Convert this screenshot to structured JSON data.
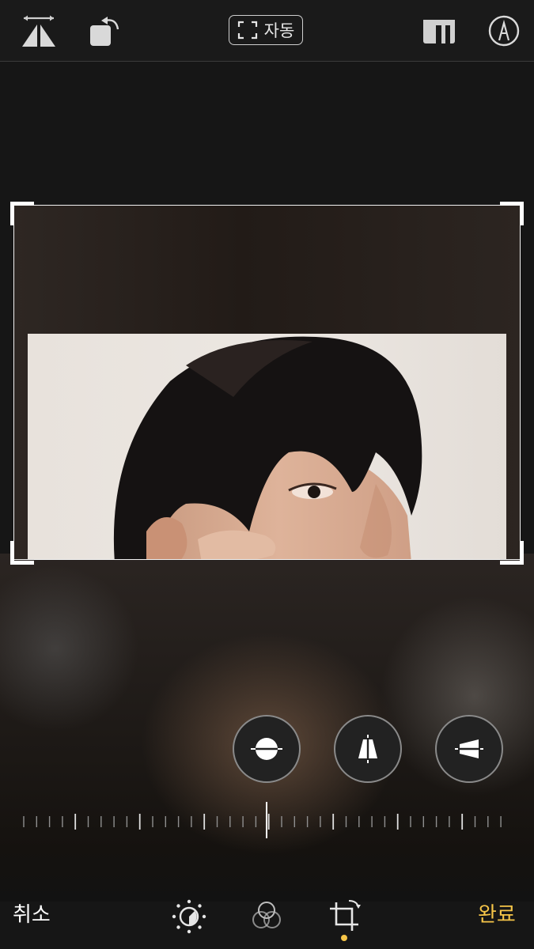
{
  "toolbar": {
    "auto_label": "자동",
    "icons": [
      "flip-horizontal-icon",
      "rotate-icon",
      "auto-crop-icon",
      "aspect-ratio-icon",
      "markup-icon"
    ]
  },
  "photo": {
    "description_visible": false
  },
  "perspective_controls": [
    {
      "name": "straighten",
      "icon": "straighten-icon"
    },
    {
      "name": "vertical",
      "icon": "vertical-perspective-icon"
    },
    {
      "name": "horizontal",
      "icon": "horizontal-perspective-icon"
    }
  ],
  "slider": {
    "value": 0
  },
  "bottom_bar": {
    "cancel_label": "취소",
    "done_label": "완료",
    "tools": [
      "adjust-icon",
      "filters-icon",
      "crop-icon"
    ],
    "active_tool": "crop"
  },
  "colors": {
    "accent": "#f6c548",
    "background": "#161616"
  }
}
